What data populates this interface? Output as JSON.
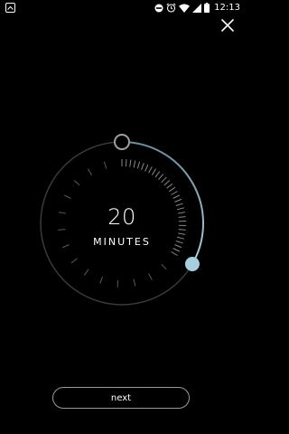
{
  "status_bar": {
    "time": "12:13",
    "icons": [
      "app-notification-icon",
      "do-not-disturb-icon",
      "alarm-icon",
      "wifi-icon",
      "signal-icon",
      "battery-icon"
    ]
  },
  "timer": {
    "value": "20",
    "unit_label": "MINUTES",
    "minutes": 20,
    "max_minutes": 60
  },
  "actions": {
    "next_label": "next",
    "close_icon": "close-icon"
  },
  "colors": {
    "background": "#000000",
    "accent": "#a8cfe0",
    "ring": "#3a3a3a",
    "tick": "#7a7a7a"
  }
}
